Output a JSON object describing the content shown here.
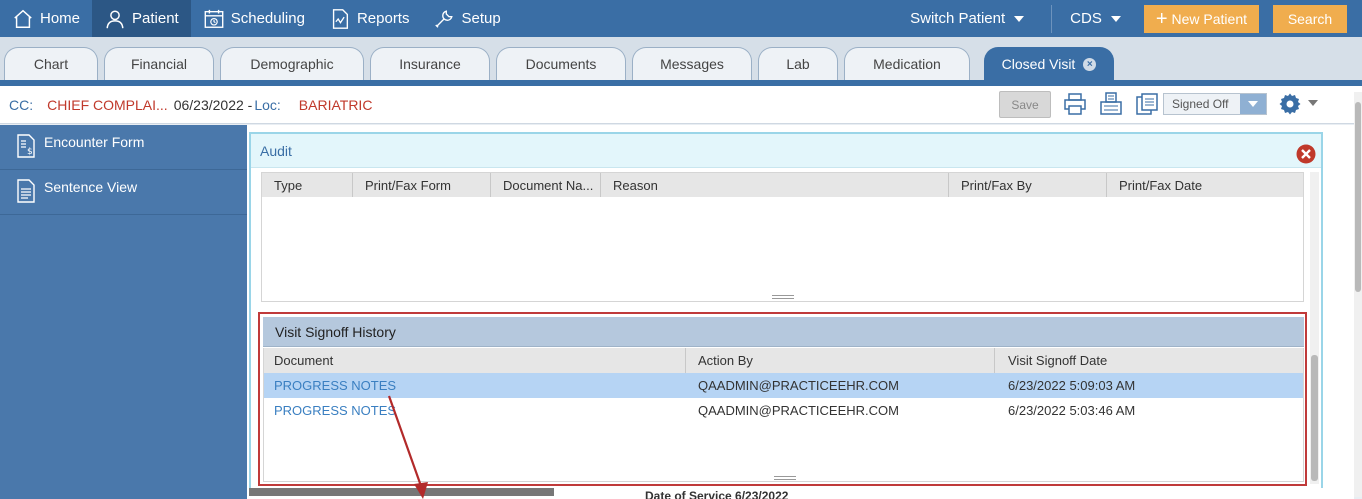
{
  "topnav": {
    "items": [
      {
        "label": "Home",
        "icon": "home-icon"
      },
      {
        "label": "Patient",
        "icon": "patient-icon"
      },
      {
        "label": "Scheduling",
        "icon": "calendar-icon"
      },
      {
        "label": "Reports",
        "icon": "reports-icon"
      },
      {
        "label": "Setup",
        "icon": "wrench-icon"
      }
    ],
    "switch_patient": "Switch Patient",
    "cds": "CDS",
    "new_patient": "New Patient",
    "search": "Search"
  },
  "tabs": [
    {
      "label": "Chart"
    },
    {
      "label": "Financial"
    },
    {
      "label": "Demographic"
    },
    {
      "label": "Insurance"
    },
    {
      "label": "Documents"
    },
    {
      "label": "Messages"
    },
    {
      "label": "Lab"
    },
    {
      "label": "Medication"
    },
    {
      "label": "Closed Visit"
    }
  ],
  "ccbar": {
    "cc_label": "CC:",
    "cc_value": "CHIEF COMPLAI...",
    "date": "06/23/2022 -",
    "loc_label": "Loc:",
    "loc_value": "BARIATRIC",
    "save_label": "Save",
    "signed_off": "Signed Off"
  },
  "sidebar": {
    "items": [
      {
        "label": "Encounter Form",
        "icon": "encounter-form-icon"
      },
      {
        "label": "Sentence View",
        "icon": "document-icon"
      }
    ]
  },
  "audit": {
    "title": "Audit",
    "columns": [
      "Type",
      "Print/Fax Form",
      "Document Na...",
      "Reason",
      "Print/Fax By",
      "Print/Fax Date"
    ]
  },
  "signoff": {
    "title": "Visit Signoff History",
    "columns": [
      "Document",
      "Action By",
      "Visit Signoff Date"
    ],
    "rows": [
      {
        "document": "PROGRESS NOTES",
        "action_by": "QAADMIN@PRACTICEEHR.COM",
        "date": "6/23/2022 5:09:03 AM"
      },
      {
        "document": "PROGRESS NOTES",
        "action_by": "QAADMIN@PRACTICEEHR.COM",
        "date": "6/23/2022 5:03:46 AM"
      }
    ]
  },
  "behind": {
    "text": "Date of Service   6/23/2022"
  },
  "colors": {
    "nav_blue": "#3a6ea5",
    "accent_orange": "#f0ad4e",
    "cc_red": "#c0392b",
    "highlight_red": "#c03a3a",
    "link_blue": "#3a7fc1",
    "selected_row": "#b6d4f4"
  }
}
